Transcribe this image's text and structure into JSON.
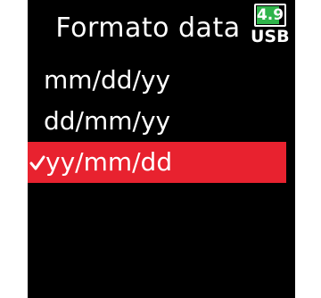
{
  "header": {
    "title": "Formato data",
    "battery": {
      "value": "4.9",
      "label": "USB",
      "level": 0.85,
      "color": "#2fb44a"
    }
  },
  "menu": {
    "items": [
      {
        "label": "mm/dd/yy",
        "selected": false
      },
      {
        "label": "dd/mm/yy",
        "selected": false
      },
      {
        "label": "yy/mm/dd",
        "selected": true
      }
    ],
    "selected_color": "#e8222f",
    "check_icon": "check-icon"
  }
}
